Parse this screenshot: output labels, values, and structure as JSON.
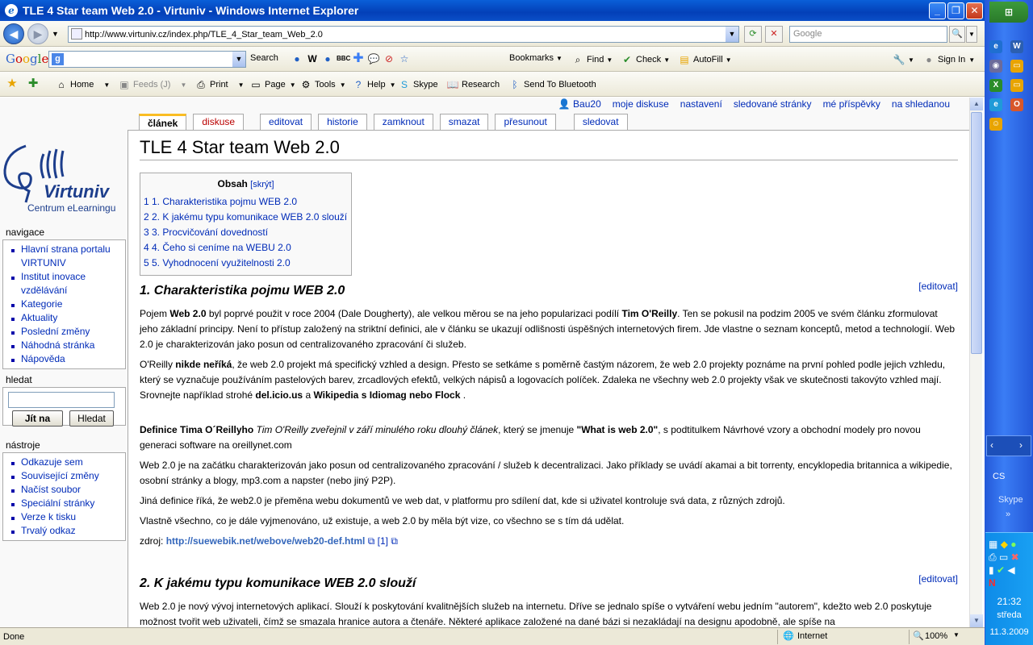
{
  "window": {
    "title": "TLE 4 Star team Web 2.0 - Virtuniv - Windows Internet Explorer"
  },
  "address": {
    "url": "http://www.virtuniv.cz/index.php/TLE_4_Star_team_Web_2.0",
    "search_placeholder": "Google"
  },
  "googlebar": {
    "logo": "Google",
    "search": "Search",
    "bookmarks": "Bookmarks",
    "find": "Find",
    "check": "Check",
    "autofill": "AutoFill",
    "signin": "Sign In"
  },
  "favbar": {
    "home": "Home",
    "feeds": "Feeds (J)",
    "print": "Print",
    "page": "Page",
    "tools": "Tools",
    "help": "Help",
    "skype": "Skype",
    "research": "Research",
    "bluetooth": "Send To Bluetooth"
  },
  "personal": [
    "Bau20",
    "moje diskuse",
    "nastavení",
    "sledované stránky",
    "mé příspěvky",
    "na shledanou"
  ],
  "tabs": [
    {
      "label": "článek"
    },
    {
      "label": "diskuse"
    },
    {
      "label": "editovat"
    },
    {
      "label": "historie"
    },
    {
      "label": "zamknout"
    },
    {
      "label": "smazat"
    },
    {
      "label": "přesunout"
    },
    {
      "label": "sledovat"
    }
  ],
  "logo": {
    "word": "Virtuniv",
    "sub": "Centrum eLearningu"
  },
  "nav": {
    "title": "navigace",
    "items": [
      "Hlavní strana portalu VIRTUNIV",
      "Institut inovace vzdělávání",
      "Kategorie",
      "Aktuality",
      "Poslední změny",
      "Náhodná stránka",
      "Nápověda"
    ]
  },
  "search": {
    "title": "hledat",
    "go": "Jít na",
    "find": "Hledat"
  },
  "tools": {
    "title": "nástroje",
    "items": [
      "Odkazuje sem",
      "Související změny",
      "Načíst soubor",
      "Speciální stránky",
      "Verze k tisku",
      "Trvalý odkaz"
    ]
  },
  "article": {
    "title": "TLE 4 Star team Web 2.0",
    "toc_title": "Obsah",
    "toc_hide": "[skrýt]",
    "toc": [
      "1 1. Charakteristika pojmu WEB 2.0",
      "2 2. K jakému typu komunikace WEB 2.0 slouží",
      "3 3. Procvičování dovedností",
      "4 4. Čeho si ceníme na WEBU 2.0",
      "5 5. Vyhodnocení využitelnosti 2.0"
    ],
    "edit": "[editovat]",
    "h1": "1. Charakteristika pojmu WEB 2.0",
    "h2": "2. K jakému typu komunikace WEB 2.0 slouží",
    "p1": [
      "Pojem ",
      "Web 2.0",
      " byl poprvé použit v roce 2004 (Dale Dougherty), ale velkou měrou se na jeho popularizaci podílí ",
      "Tim O'Reilly",
      ". Ten se pokusil na podzim 2005 ve svém článku zformulovat jeho základní principy. Není to přístup založený na striktní definici, ale v článku se ukazují odlišnosti úspěšných internetových firem. Jde vlastne o seznam konceptů, metod a technologií. Web 2.0 je charakterizován jako posun od centralizovaného zpracování či služeb."
    ],
    "p2": [
      "O'Reilly ",
      "nikde neříká",
      ", že web 2.0 projekt má specifický vzhled a design. Přesto se setkáme s poměrně častým názorem, že web 2.0 projekty poznáme na první pohled podle jejich vzhledu, který se vyznačuje používáním pastelových barev, zrcadlových efektů, velkých nápisů a logovacích políček. Zdaleka ne všechny web 2.0 projekty však ve skutečnosti takovýto vzhled mají. Srovnejte například strohé ",
      "del.icio.us",
      " a ",
      "Wikipedia s Idiomag nebo Flock",
      " ."
    ],
    "p3": [
      "Definice Tima O´Reillyho",
      " ",
      "Tim O'Reilly zveřejnil v září minulého roku dlouhý článek",
      ", který se jmenuje ",
      "\"What is web 2.0\"",
      ", s podtitulkem Návrhové vzory a obchodní modely pro novou generaci software na oreillynet.com"
    ],
    "p4": "Web 2.0 je na začátku charakterizován jako posun od centralizovaného zpracování / služeb k decentralizaci. Jako příklady se uvádí akamai a bit torrenty, encyklopedia britannica a wikipedie, osobní stránky a blogy, mp3.com a napster (nebo jiný P2P).",
    "p5": "Jiná definice říká, že web2.0 je přeměna webu dokumentů ve web dat, v platformu pro sdílení dat, kde si uživatel kontroluje svá data, z různých zdrojů.",
    "p6": "Vlastně všechno, co je dále vyjmenováno, už existuje, a web 2.0 by měla být vize, co všechno se s tím dá udělat.",
    "p7": [
      "zdroj: ",
      "http://suewebik.net/webove/web20-def.html",
      "[1]"
    ],
    "p8": "Web 2.0 je nový vývoj internetových aplikací. Slouží k poskytování kvalitnějších služeb na internetu. Dříve se jednalo spíše o vytváření webu jedním \"autorem\", kdežto web 2.0 poskytuje možnost tvořit web uživateli, čímž se smazala hranice autora a čtenáře. Některé aplikace založené na dané bázi si nezakládají na designu apodobně, ale spíše na"
  },
  "status": {
    "done": "Done",
    "zone": "Internet",
    "zoom": "100%"
  },
  "tray": {
    "lang": "CS",
    "skype": "Skype",
    "time": "21:32",
    "day": "středa",
    "date": "11.3.2009"
  }
}
